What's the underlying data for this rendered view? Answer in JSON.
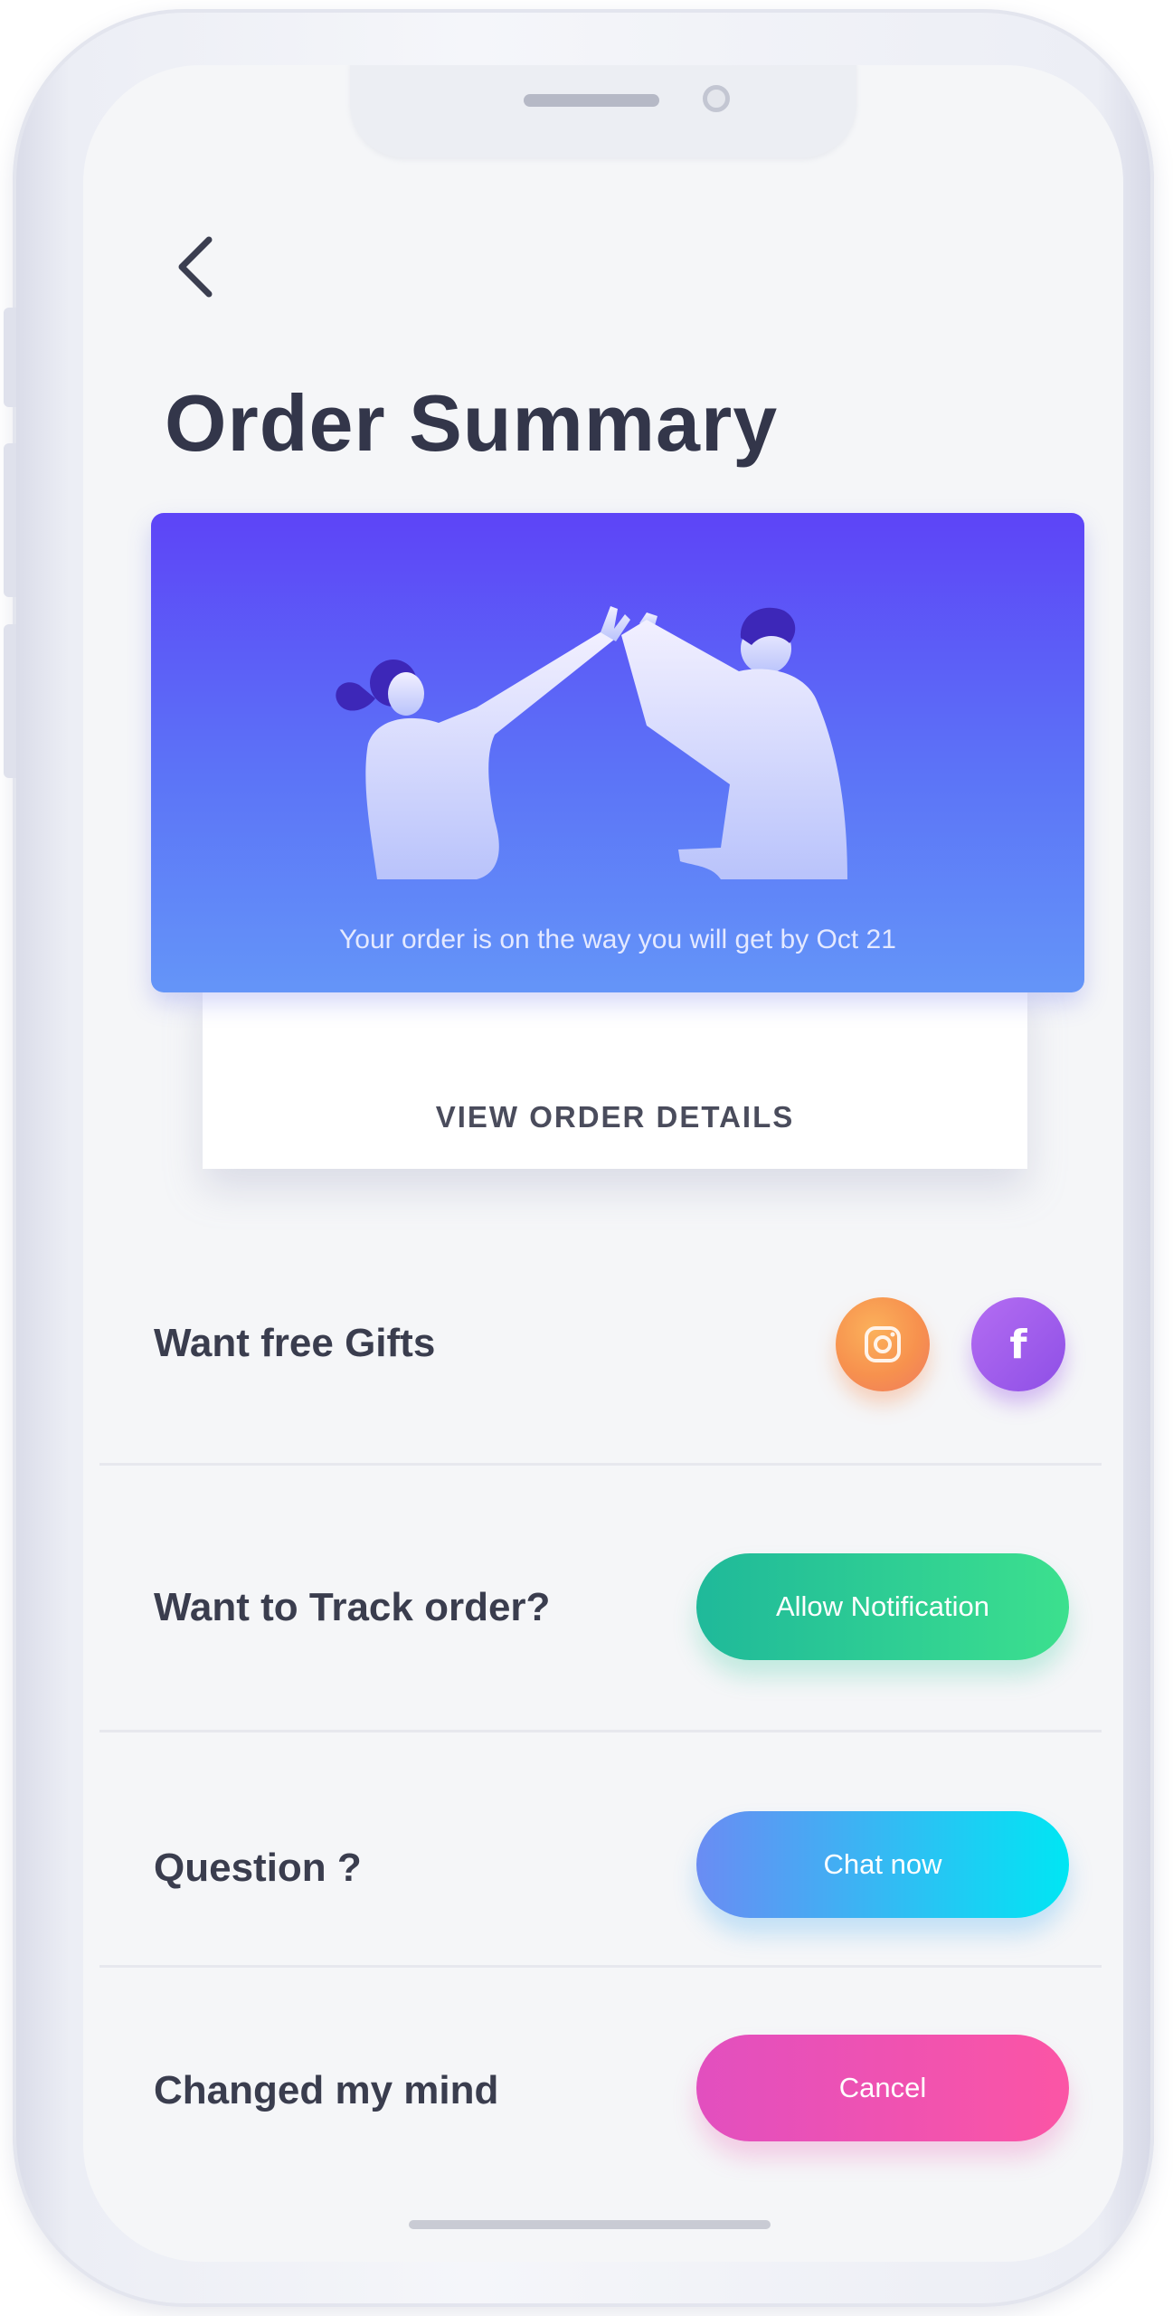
{
  "header": {
    "back_icon": "chevron-left-icon",
    "title": "Order Summary"
  },
  "banner": {
    "message": "Your order is on the way you will get by Oct 21",
    "illustration": "high-five-illustration",
    "details_label": "VIEW ORDER DETAILS"
  },
  "rows": {
    "gifts": {
      "label": "Want free Gifts",
      "icons": [
        "instagram-icon",
        "facebook-icon"
      ],
      "facebook_glyph": "f"
    },
    "track": {
      "label": "Want to Track order?",
      "button": "Allow Notification"
    },
    "question": {
      "label": "Question ?",
      "button": "Chat now"
    },
    "cancel": {
      "label": "Changed my mind",
      "button": "Cancel"
    }
  },
  "colors": {
    "banner_top": "#5d44f7",
    "banner_bottom": "#6495f8",
    "allow_start": "#1fb99a",
    "allow_end": "#3ce08e",
    "chat_start": "#6a8cf3",
    "chat_end": "#00e6f3",
    "cancel_start": "#e24fbf",
    "cancel_end": "#fb55a5",
    "title_text": "#33364a"
  }
}
